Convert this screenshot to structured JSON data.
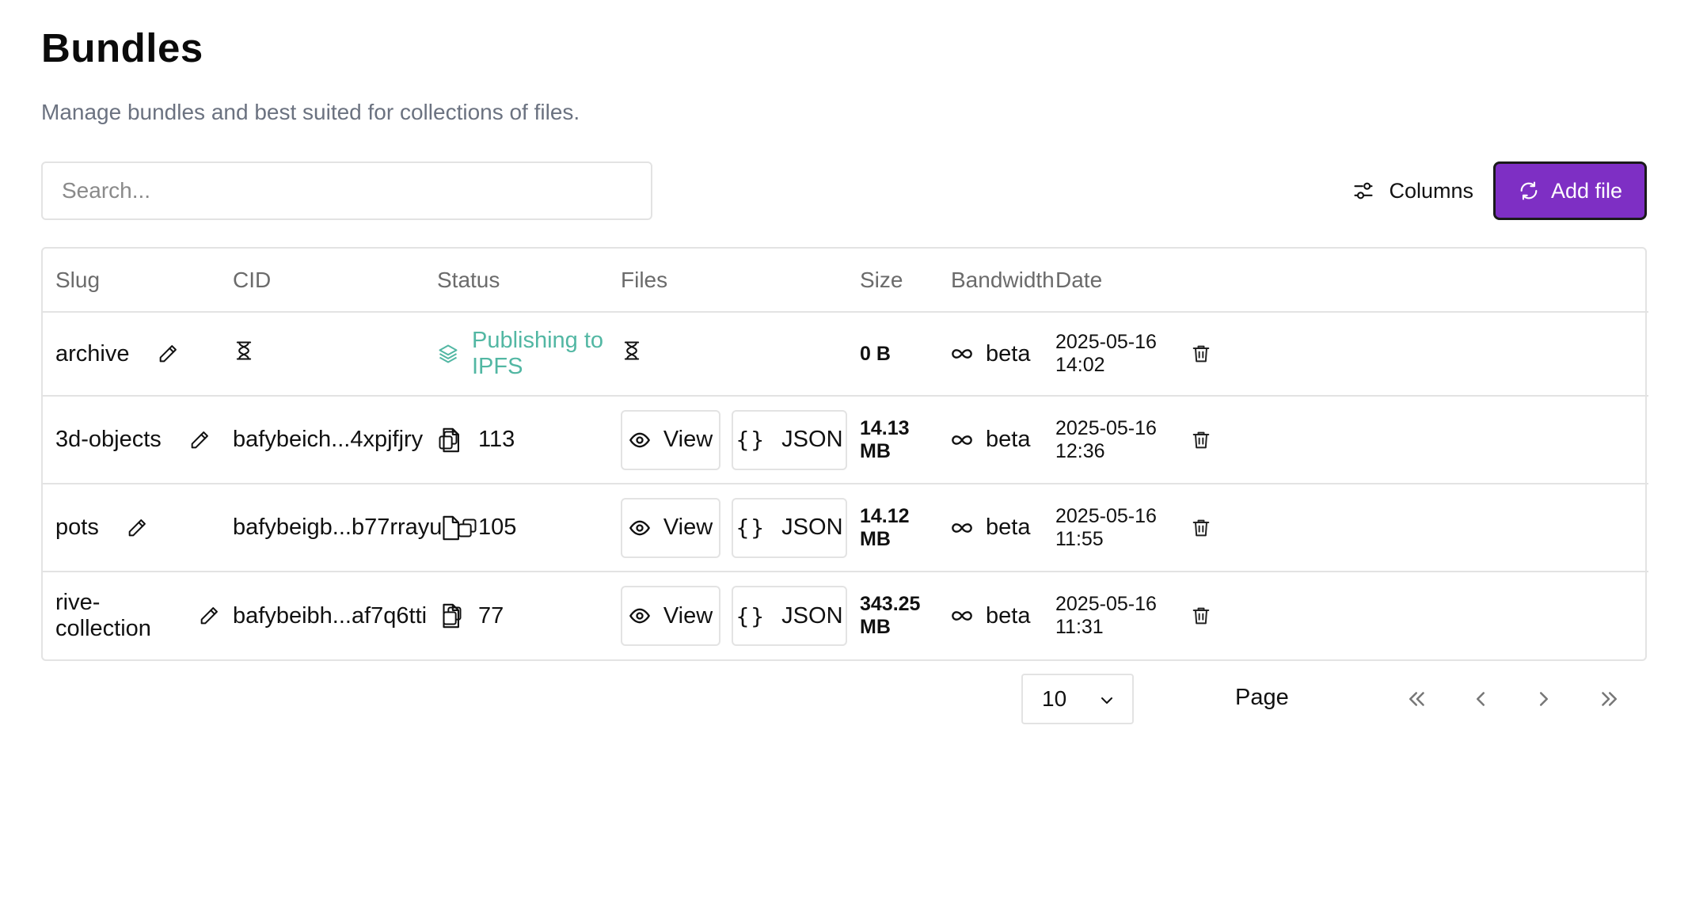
{
  "header": {
    "title": "Bundles",
    "subtitle": "Manage bundles and best suited for collections of files."
  },
  "toolbar": {
    "search_placeholder": "Search...",
    "columns_label": "Columns",
    "add_label": "Add file"
  },
  "table": {
    "columns": [
      "Slug",
      "CID",
      "Status",
      "Files",
      "Size",
      "Bandwidth",
      "Date"
    ],
    "rows": [
      {
        "slug": "archive",
        "cid": "",
        "status": "Publishing to IPFS",
        "files_count": "",
        "size": "0 B",
        "bandwidth": "beta",
        "date": "2025-05-16 14:02"
      },
      {
        "slug": "3d-objects",
        "cid": "bafybeich...4xpjfjry",
        "status": "113",
        "files_count": "",
        "view_label": "View",
        "json_label": "JSON",
        "size": "14.13 MB",
        "bandwidth": "beta",
        "date": "2025-05-16 12:36"
      },
      {
        "slug": "pots",
        "cid": "bafybeigb...b77rrayu",
        "status": "105",
        "view_label": "View",
        "json_label": "JSON",
        "size": "14.12 MB",
        "bandwidth": "beta",
        "date": "2025-05-16 11:55"
      },
      {
        "slug": "rive-collection",
        "cid": "bafybeibh...af7q6tti",
        "status": "77",
        "view_label": "View",
        "json_label": "JSON",
        "size": "343.25 MB",
        "bandwidth": "beta",
        "date": "2025-05-16 11:31"
      }
    ]
  },
  "pagination": {
    "page_size": "10",
    "page_label": "Page"
  },
  "colors": {
    "accent": "#7e2fc4",
    "publishing": "#52b7a3",
    "border": "#e3e3e3"
  },
  "icons": {
    "row_edit": "pencil-icon",
    "row_copy": "copy-icon",
    "row_files": "file-icon",
    "row_pending": "hourglass-icon",
    "row_publishing": "layers-icon",
    "row_view": "eye-icon",
    "row_json": "braces-icon",
    "row_bandwidth": "infinity-icon",
    "row_delete": "trash-icon"
  }
}
